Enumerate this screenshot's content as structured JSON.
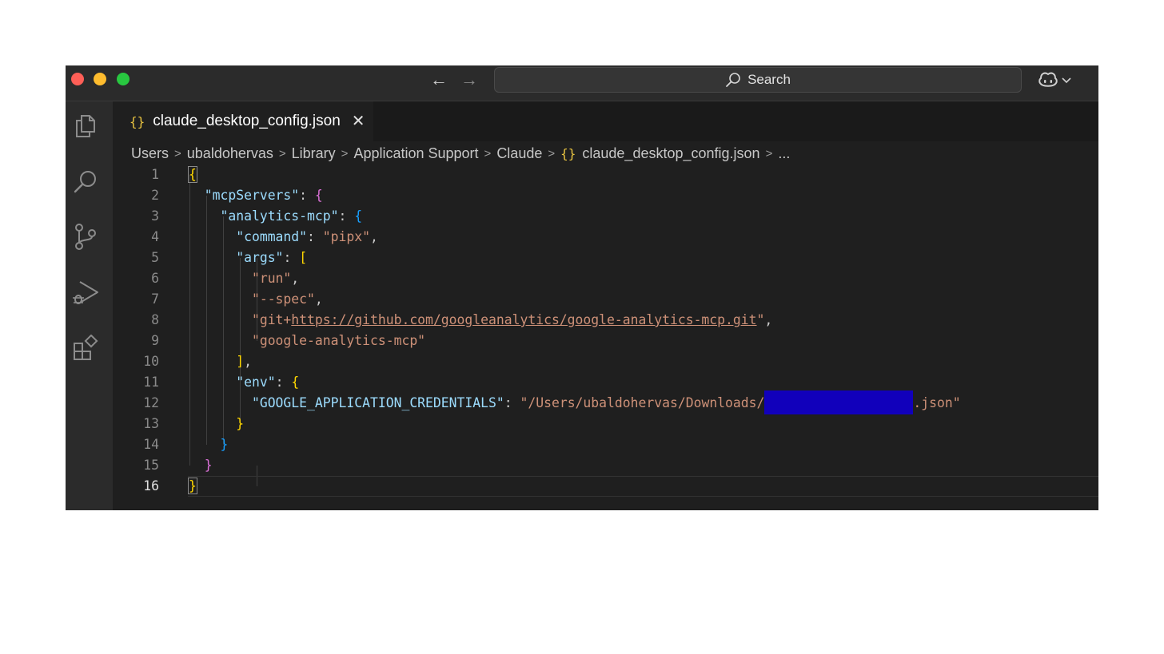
{
  "titlebar": {
    "search_label": "Search"
  },
  "tab": {
    "braces": "{}",
    "title": "claude_desktop_config.json",
    "close": "✕"
  },
  "breadcrumb": {
    "items": [
      "Users",
      "ubaldohervas",
      "Library",
      "Application Support",
      "Claude"
    ],
    "file": "claude_desktop_config.json",
    "ellipsis": "..."
  },
  "editor": {
    "line_numbers": [
      "1",
      "2",
      "3",
      "4",
      "5",
      "6",
      "7",
      "8",
      "9",
      "10",
      "11",
      "12",
      "13",
      "14",
      "15",
      "16"
    ],
    "active_line": "16",
    "code": {
      "mcp_servers_key": "\"mcpServers\"",
      "server_key": "\"analytics-mcp\"",
      "command_key": "\"command\"",
      "command_value": "\"pipx\"",
      "args_key": "\"args\"",
      "arg_run": "\"run\"",
      "arg_spec": "\"--spec\"",
      "arg_git_prefix": "\"git+",
      "arg_git_url": "https://github.com/googleanalytics/google-analytics-mcp.git",
      "arg_git_suffix": "\"",
      "arg_pkg": "\"google-analytics-mcp\"",
      "env_key": "\"env\"",
      "cred_key": "\"GOOGLE_APPLICATION_CREDENTIALS\"",
      "cred_value_prefix": "\"/Users/ubaldohervas/Downloads/",
      "cred_value_suffix": ".json\""
    }
  }
}
